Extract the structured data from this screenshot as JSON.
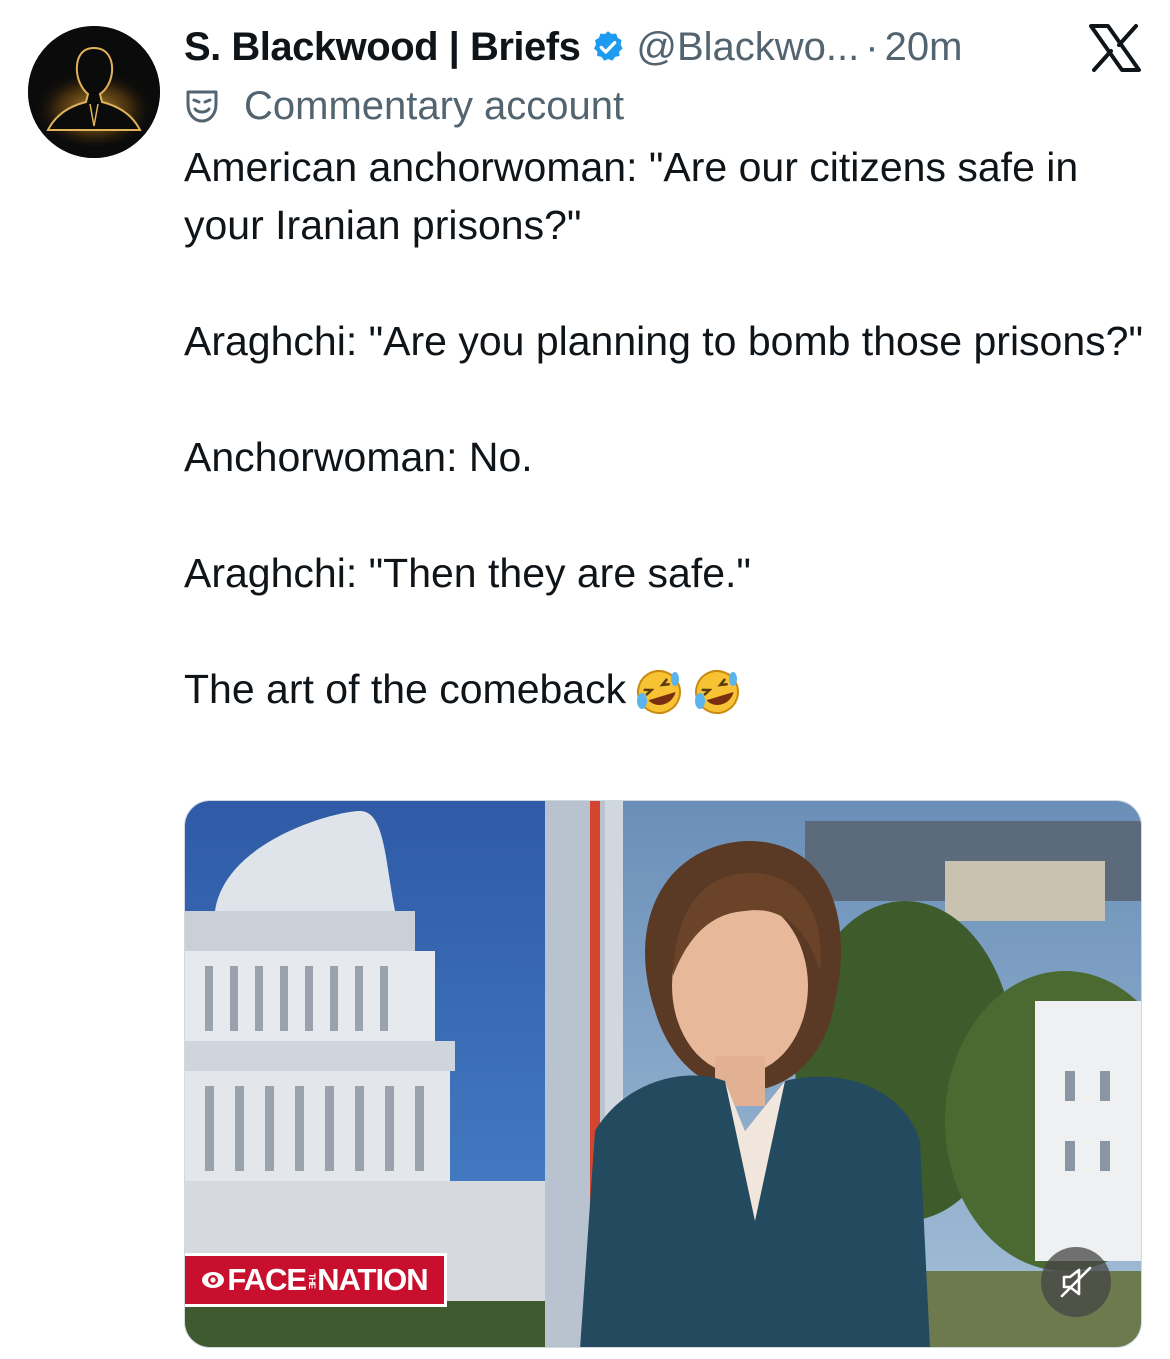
{
  "author": {
    "display_name": "S. Blackwood | Briefs",
    "handle": "@Blackwo...",
    "separator": "·",
    "timestamp": "20m",
    "label": "Commentary account"
  },
  "post": {
    "lines": [
      "American anchorwoman: \"Are our citizens safe in your Iranian prisons?\"",
      "Araghchi: \"Are you planning to bomb those prisons?\"",
      "Anchorwoman: No.",
      "Araghchi: \"Then they are safe.\"",
      "The art of the comeback"
    ],
    "emoji": [
      "rolling-on-floor-laughing",
      "rolling-on-floor-laughing"
    ]
  },
  "media": {
    "chyron": "FACE",
    "chyron_small": "THE",
    "chyron_end": "NATION"
  },
  "colors": {
    "verified": "#1d9bf0",
    "text": "#0f1419",
    "secondary": "#536471",
    "chyron": "#c8102e"
  },
  "icons": [
    "x-logo-icon",
    "verified-badge-icon",
    "theater-mask-icon",
    "mute-icon"
  ]
}
